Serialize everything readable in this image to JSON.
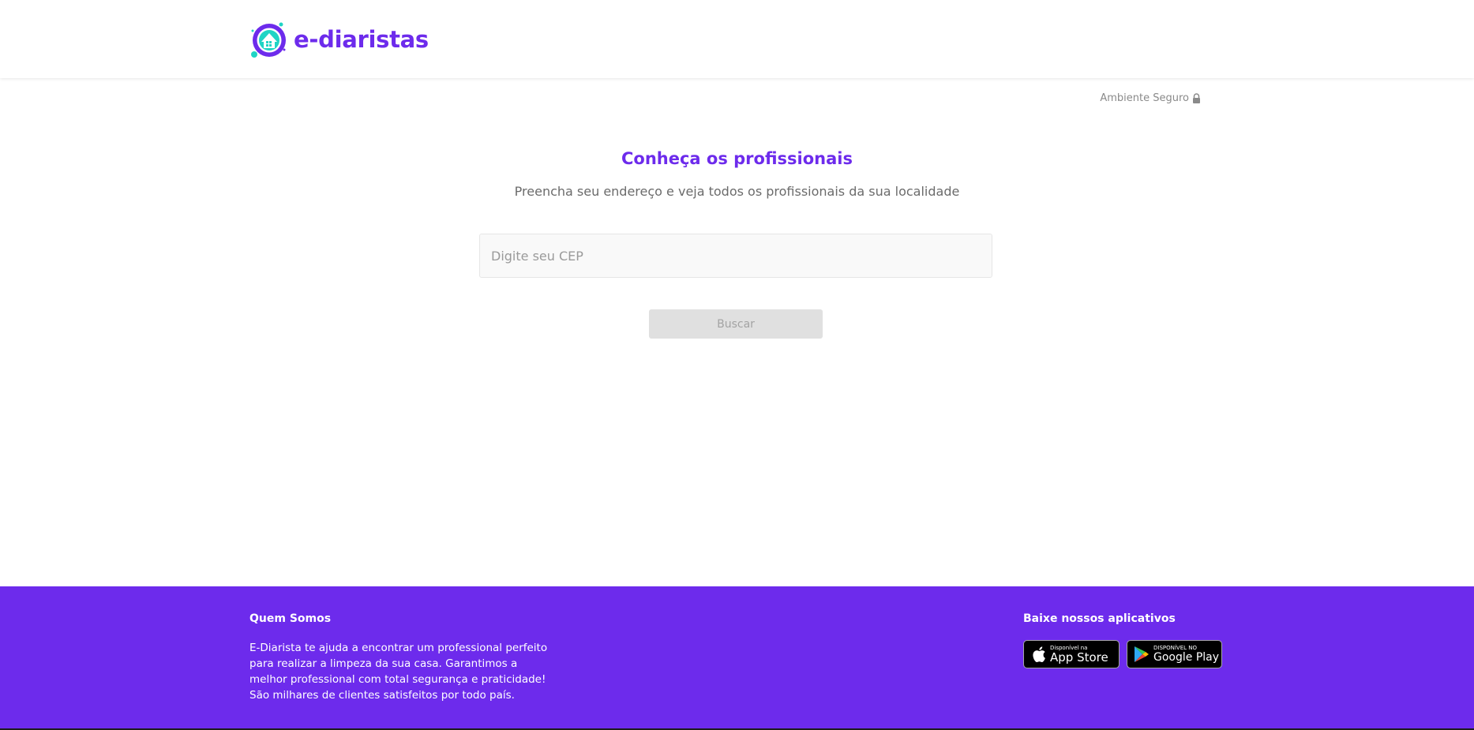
{
  "header": {
    "logo_text": "e-diaristas"
  },
  "secure": {
    "label": "Ambiente Seguro"
  },
  "main": {
    "title": "Conheça os profissionais",
    "subtitle": "Preencha seu endereço e veja todos os profissionais da sua localidade",
    "cep_placeholder": "Digite seu CEP",
    "cep_value": "",
    "search_label": "Buscar"
  },
  "footer": {
    "about_title": "Quem Somos",
    "about_lines": [
      "E-Diarista te ajuda a encontrar um professional perfeito",
      "para realizar a limpeza da sua casa. Garantimos a",
      "melhor professional com total segurança e praticidade!",
      "São milhares de clientes satisfeitos por todo país."
    ],
    "apps_title": "Baixe nossos aplicativos",
    "app_store": {
      "small": "Disponível na",
      "big": "App Store"
    },
    "google_play": {
      "small": "DISPONÍVEL NO",
      "big": "Google Play"
    }
  },
  "colors": {
    "brand_purple": "#6d2bec",
    "accent_teal": "#20d4c5",
    "disabled_button": "#e0e0e0"
  }
}
